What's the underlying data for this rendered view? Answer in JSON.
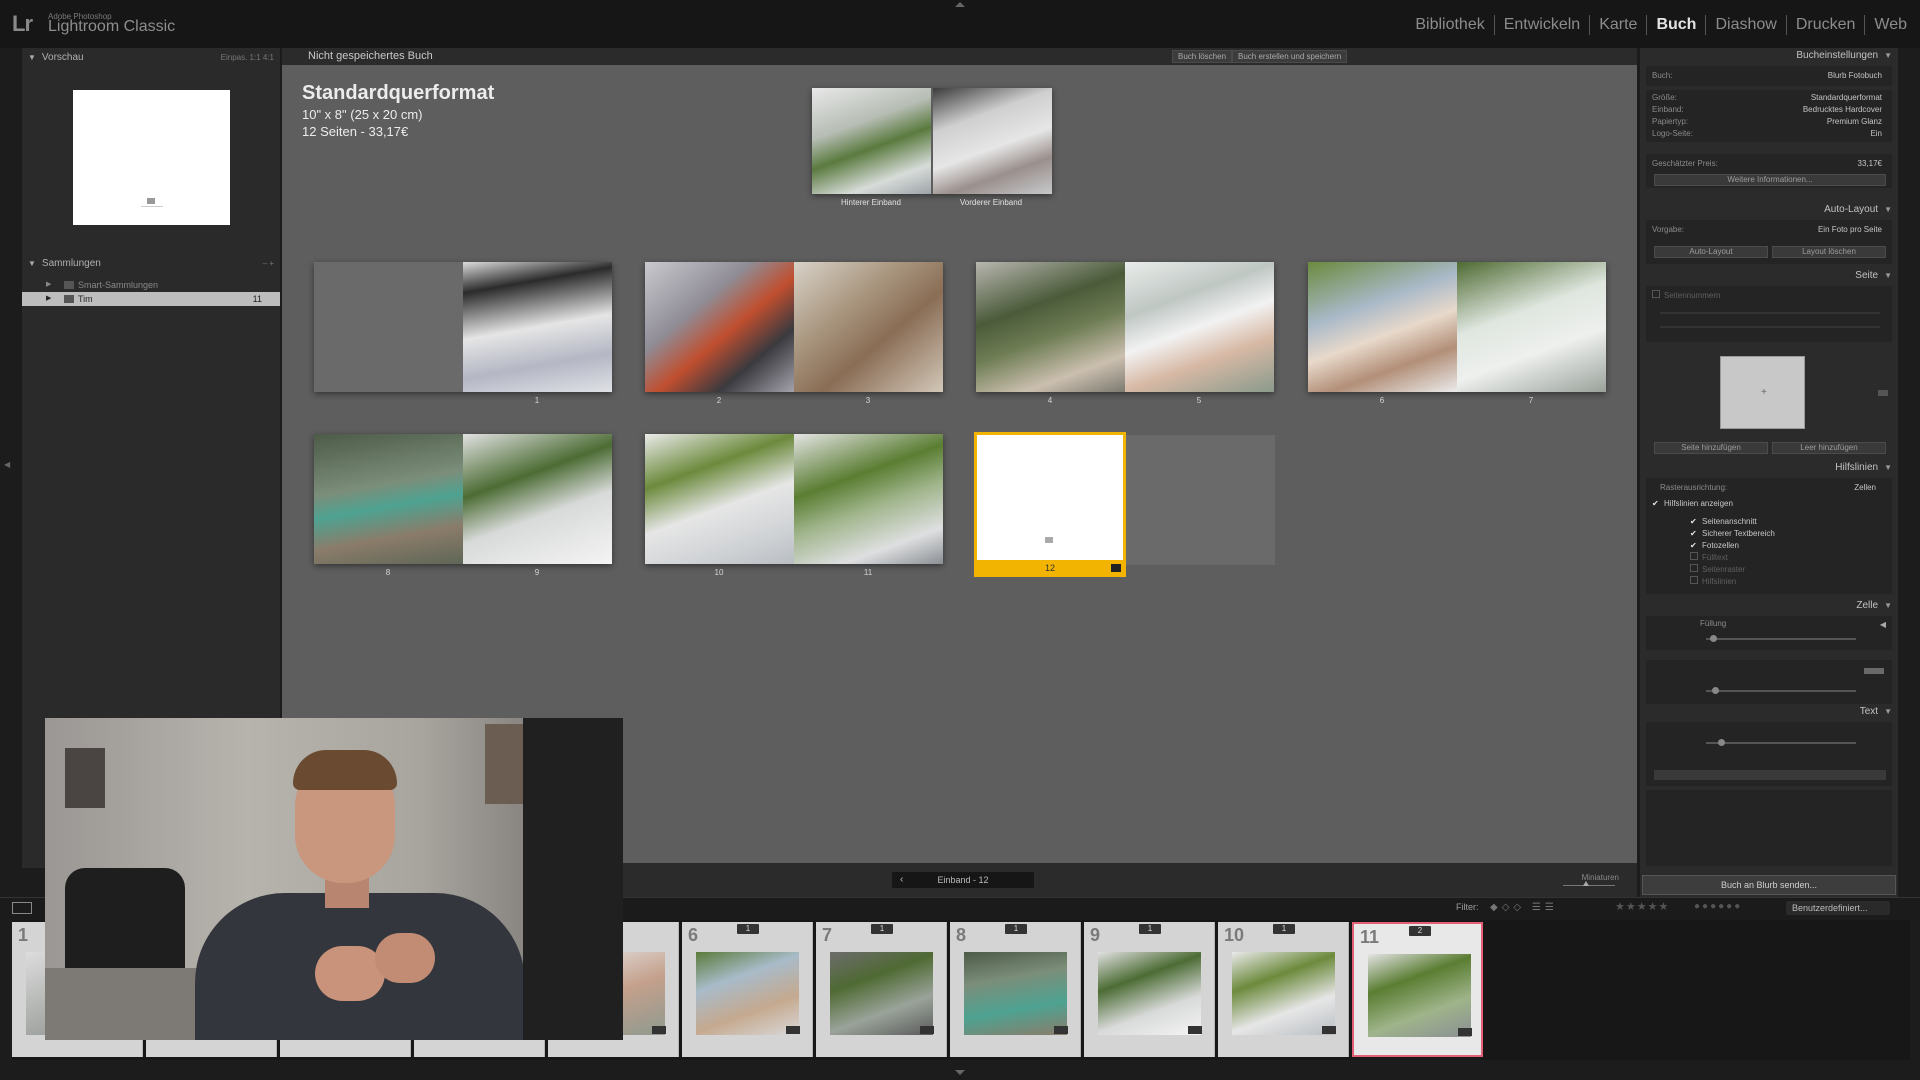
{
  "app": {
    "logo": "Lr",
    "vendor": "Adobe Photoshop",
    "name": "Lightroom Classic"
  },
  "modules": [
    {
      "label": "Bibliothek",
      "active": false
    },
    {
      "label": "Entwickeln",
      "active": false
    },
    {
      "label": "Karte",
      "active": false
    },
    {
      "label": "Buch",
      "active": true
    },
    {
      "label": "Diashow",
      "active": false
    },
    {
      "label": "Drucken",
      "active": false
    },
    {
      "label": "Web",
      "active": false
    }
  ],
  "left_panel": {
    "preview_title": "Vorschau",
    "preview_modes": "Einpas.   1:1   4:1",
    "collections_title": "Sammlungen",
    "collections_controls": "–   +",
    "collections": [
      {
        "label": "Smart-Sammlungen",
        "count": ""
      },
      {
        "label": "Tim",
        "count": "11"
      }
    ]
  },
  "center": {
    "header_title": "Nicht gespeichertes Buch",
    "btn_clear": "Buch löschen",
    "btn_create": "Buch erstellen und speichern",
    "spec_title": "Standardquerformat",
    "spec_size": "10\" x 8\" (25 x 20 cm)",
    "spec_pages": "12 Seiten - 33,17€",
    "cover_back": "Hinterer Einband",
    "cover_front": "Vorderer Einband",
    "page_numbers": [
      "1",
      "2",
      "3",
      "4",
      "5",
      "6",
      "7",
      "8",
      "9",
      "10",
      "11",
      "12"
    ],
    "selected_page": "12"
  },
  "navbar": {
    "location": "Einband - 12",
    "thumbnails_label": "Miniaturen"
  },
  "right_panel": {
    "book_settings_title": "Bucheinstellungen",
    "book_label": "Buch:",
    "book_value": "Blurb Fotobuch",
    "size_label": "Größe:",
    "size_value": "Standardquerformat",
    "cover_label": "Einband:",
    "cover_value": "Bedrucktes Hardcover",
    "paper_label": "Papiertyp:",
    "paper_value": "Premium Glanz",
    "logo_label": "Logo-Seite:",
    "logo_value": "Ein",
    "price_label": "Geschätzter Preis:",
    "price_value": "33,17€",
    "more_info_btn": "Weitere Informationen...",
    "autolayout_title": "Auto-Layout",
    "preset_label": "Vorgabe:",
    "preset_value": "Ein Foto pro Seite",
    "autolayout_btn": "Auto-Layout",
    "clear_layout_btn": "Layout löschen",
    "page_title": "Seite",
    "page_numbers_label": "Seitennummern",
    "add_page_btn": "Seite hinzufügen",
    "add_blank_btn": "Leer hinzufügen",
    "guides_title": "Hilfslinien",
    "grid_snap_label": "Rasterausrichtung:",
    "grid_snap_value": "Zellen",
    "show_guides_label": "Hilfslinien anzeigen",
    "guides": [
      {
        "label": "Seitenanschnitt",
        "checked": true
      },
      {
        "label": "Sicherer Textbereich",
        "checked": true
      },
      {
        "label": "Fotozellen",
        "checked": true
      },
      {
        "label": "Fülltext",
        "checked": false
      },
      {
        "label": "Seitenraster",
        "checked": false
      },
      {
        "label": "Hilfslinien",
        "checked": false
      }
    ],
    "cell_title": "Zelle",
    "padding_label": "Füllung",
    "text_title": "Text",
    "send_btn": "Buch an Blurb senden..."
  },
  "filterbar": {
    "filter_label": "Filter:",
    "stars": "★★★★★",
    "custom_label": "Benutzerdefiniert..."
  },
  "filmstrip": {
    "cells": [
      {
        "n": "1",
        "badge": ""
      },
      {
        "n": "",
        "badge": ""
      },
      {
        "n": "",
        "badge": ""
      },
      {
        "n": "",
        "badge": ""
      },
      {
        "n": "5",
        "badge": "1"
      },
      {
        "n": "6",
        "badge": "1"
      },
      {
        "n": "7",
        "badge": "1"
      },
      {
        "n": "8",
        "badge": "1"
      },
      {
        "n": "9",
        "badge": "1"
      },
      {
        "n": "10",
        "badge": "1"
      },
      {
        "n": "11",
        "badge": "2"
      }
    ]
  },
  "colors": {
    "accent_selected": "#f2b400",
    "filmstrip_selected": "#e35f78",
    "active_module": "#e4e4e4"
  }
}
